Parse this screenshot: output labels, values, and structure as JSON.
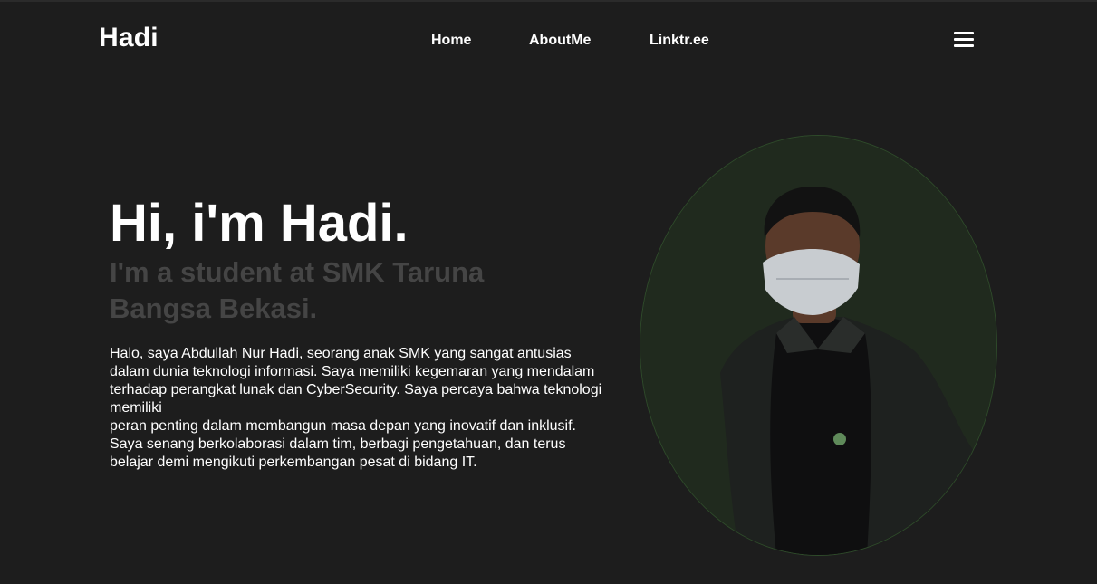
{
  "nav": {
    "brand": "Hadi",
    "links": [
      {
        "label": "Home"
      },
      {
        "label": "AboutMe"
      },
      {
        "label": "Linktr.ee"
      }
    ],
    "menu_icon": "hamburger-menu-icon"
  },
  "hero": {
    "title": "Hi, i'm Hadi.",
    "subtitle": "I'm a student at SMK Taruna Bangsa Bekasi.",
    "bio_lines": [
      "Halo, saya Abdullah Nur Hadi, seorang anak SMK yang sangat antusias",
      "dalam dunia teknologi informasi. Saya memiliki kegemaran yang mendalam",
      "terhadap perangkat lunak dan CyberSecurity. Saya percaya bahwa teknologi",
      "memiliki",
      "peran penting dalam membangun masa depan yang inovatif dan inklusif.",
      "Saya senang berkolaborasi dalam tim, berbagi pengetahuan, dan terus",
      "belajar demi mengikuti perkembangan pesat di bidang IT."
    ]
  },
  "portrait": {
    "icon": "profile-photo",
    "colors": {
      "background": "#202a1e",
      "border": "#2e4a2a",
      "jacket": "#1e211f",
      "shirt": "#0f0f10",
      "skin": "#5a3a2a",
      "hair": "#121212",
      "mask": "#c8ccd0"
    }
  }
}
